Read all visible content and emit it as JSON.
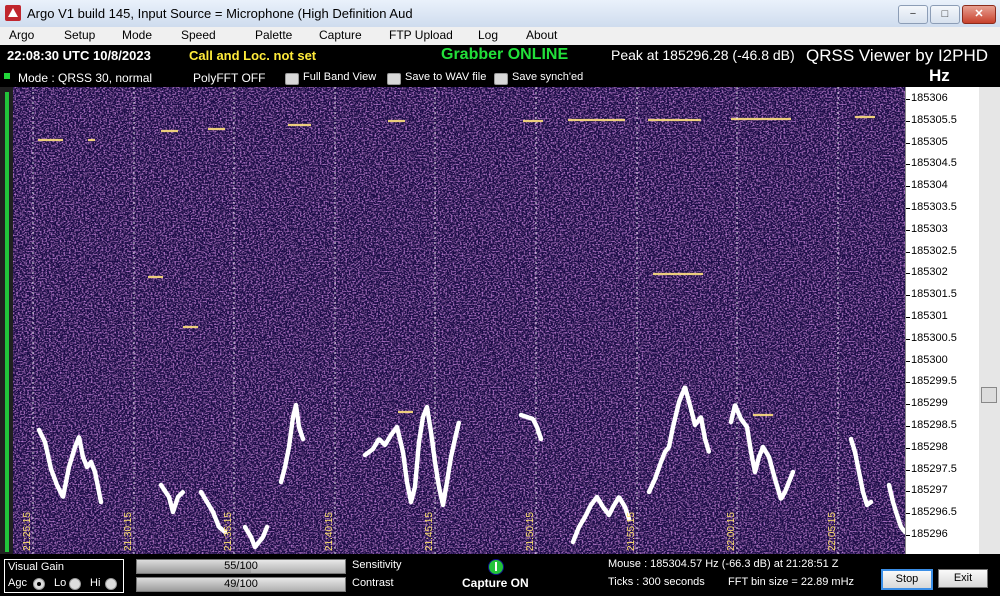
{
  "window": {
    "title": "Argo V1 build 145, Input Source = Microphone (High Definition Aud",
    "minimize": "−",
    "maximize": "□",
    "close": "✕"
  },
  "menu": [
    "Argo",
    "Setup",
    "Mode",
    "Speed",
    "Palette",
    "Capture",
    "FTP Upload",
    "Log",
    "About"
  ],
  "info": {
    "utc": "22:08:30 UTC  10/8/2023",
    "call": "Call and Loc. not set",
    "grabber": "Grabber ONLINE",
    "peak": "Peak at   185296.28 (-46.8 dB)",
    "viewer": "QRSS Viewer by I2PHD",
    "unit": "Hz"
  },
  "options": {
    "mode": "Mode : QRSS 30, normal",
    "polyfft": "PolyFFT OFF",
    "full_band": "Full Band View",
    "save_wav": "Save to WAV file",
    "save_synch": "Save synch'ed"
  },
  "freq_scale": [
    "185306",
    "185305.5",
    "185305",
    "185304.5",
    "185304",
    "185303.5",
    "185303",
    "185302.5",
    "185302",
    "185301.5",
    "185301",
    "185300.5",
    "185300",
    "185299.5",
    "185299",
    "185298.5",
    "185298",
    "185297.5",
    "185297",
    "185296.5",
    "185296"
  ],
  "time_labels": [
    "21:25:15",
    "21:30:15",
    "21:35:15",
    "21:40:15",
    "21:45:15",
    "21:50:15",
    "21:55:15",
    "22:00:15",
    "22:05:15"
  ],
  "controls": {
    "visual_gain": "Visual Gain",
    "agc": "Agc",
    "lo": "Lo",
    "hi": "Hi",
    "sensitivity_value": "55/100",
    "sensitivity_level": 0.55,
    "sensitivity_label": "Sensitivity",
    "contrast_value": "49/100",
    "contrast_level": 0.49,
    "contrast_label": "Contrast",
    "capture": "Capture ON",
    "mouse": "Mouse :    185304.57 Hz  (-66.3 dB) at 21:28:51 Z",
    "ticks": "Ticks   : 300 seconds",
    "fft_bin": "FFT bin size = 22.89 mHz",
    "stop": "Stop",
    "exit": "Exit"
  },
  "colors": {
    "grabber": "#22e03a",
    "call": "#ffeb3b",
    "waterfall_bg": "#1b0f4a",
    "trace": "#ffffff",
    "carrier": "#ffe080"
  }
}
